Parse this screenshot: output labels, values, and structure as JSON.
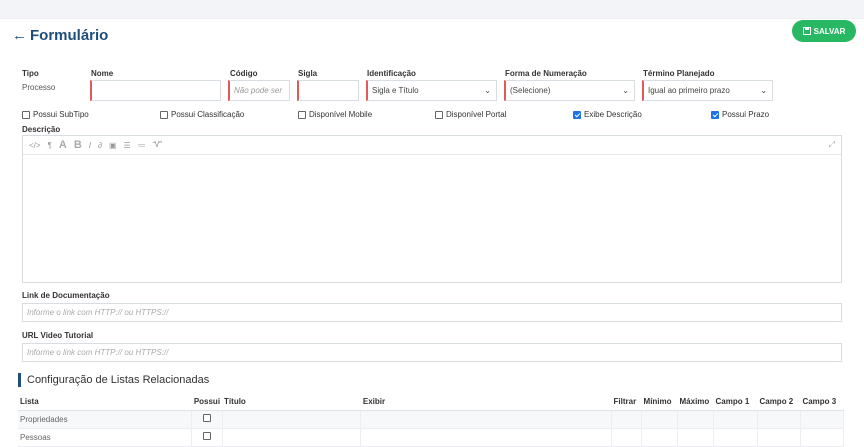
{
  "header": {
    "back_icon": "arrow-left-icon",
    "title": "Formulário",
    "save_label": "SALVAR",
    "save_icon": "floppy-disk-icon",
    "save_color": "#28b864"
  },
  "form": {
    "tipo_label": "Tipo",
    "tipo_value": "Processo",
    "nome_label": "Nome",
    "nome_value": "",
    "codigo_label": "Código",
    "codigo_placeholder": "Não pode ser",
    "sigla_label": "Sigla",
    "sigla_value": "",
    "identificacao_label": "Identificação",
    "identificacao_value": "Sigla e Título",
    "numeracao_label": "Forma de Numeração",
    "numeracao_value": "(Selecione)",
    "termino_label": "Término Planejado",
    "termino_value": "Igual ao primeiro prazo",
    "checkboxes": [
      {
        "label": "Possui SubTipo",
        "checked": false
      },
      {
        "label": "Possui Classificação",
        "checked": false
      },
      {
        "label": "Disponível Mobile",
        "checked": false
      },
      {
        "label": "Disponível Portal",
        "checked": false
      },
      {
        "label": "Exibe Descrição",
        "checked": true
      },
      {
        "label": "Possui Prazo",
        "checked": true
      }
    ],
    "descricao_label": "Descrição",
    "link_label": "Link de Documentação",
    "link_placeholder": "Informe o link com HTTP:// ou HTTPS://",
    "video_label": "URL Video Tutorial",
    "video_placeholder": "Informe o link com HTTP:// ou HTTPS://"
  },
  "lists": {
    "section_title": "Configuração de Listas Relacionadas",
    "columns": [
      "Lista",
      "Possui",
      "Título",
      "Exibir",
      "Filtrar",
      "Mínimo",
      "Máximo",
      "Campo 1",
      "Campo 2",
      "Campo 3"
    ],
    "rows": [
      {
        "name": "Propriedades",
        "possui": false
      },
      {
        "name": "Pessoas",
        "possui": false
      }
    ]
  }
}
